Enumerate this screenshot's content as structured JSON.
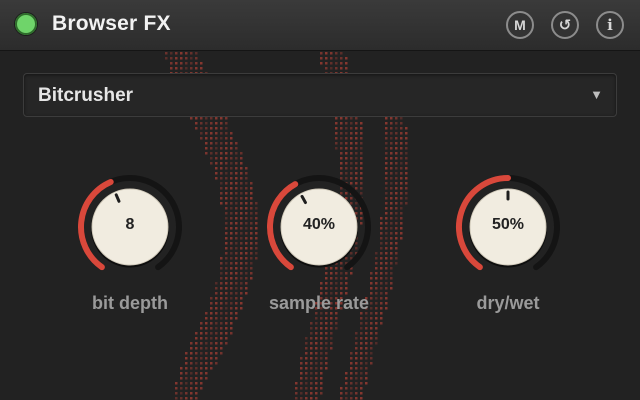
{
  "header": {
    "title": "Browser FX",
    "power_on": true,
    "buttons": {
      "midi": "M",
      "reset": "↺",
      "info": "i"
    }
  },
  "preset": {
    "selected": "Bitcrusher"
  },
  "knobs": [
    {
      "id": "bit-depth",
      "label": "bit depth",
      "display": "8",
      "level": 0.42
    },
    {
      "id": "sample-rate",
      "label": "sample rate",
      "display": "40%",
      "level": 0.4
    },
    {
      "id": "dry-wet",
      "label": "dry/wet",
      "display": "50%",
      "level": 0.5
    }
  ],
  "colors": {
    "accent": "#d9483b",
    "track": "#141414",
    "knob_face": "#f1ece0",
    "power_led": "#6fd46a"
  }
}
